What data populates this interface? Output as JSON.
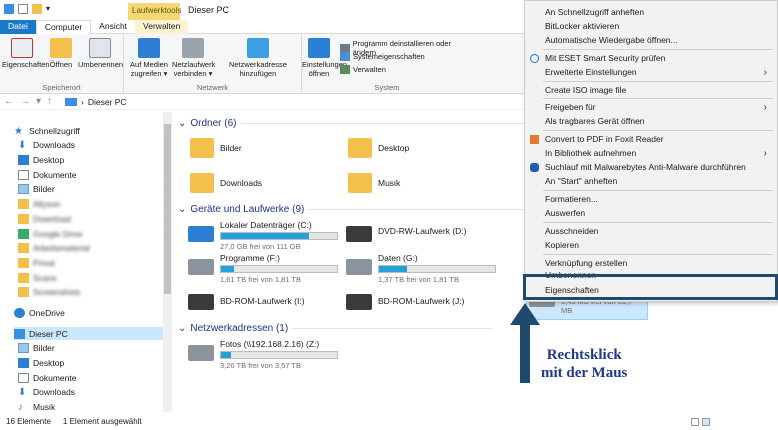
{
  "titlebar": {
    "context_tab_group": "Laufwerktools",
    "title": "Dieser PC"
  },
  "tabs": [
    {
      "label": "Datei"
    },
    {
      "label": "Computer"
    },
    {
      "label": "Ansicht"
    },
    {
      "label": "Verwalten"
    }
  ],
  "ribbon": {
    "groups": [
      {
        "label": "Speicherort"
      },
      {
        "label": "Netzwerk"
      },
      {
        "label": "System"
      }
    ],
    "buttons": {
      "properties": "Eigenschaften",
      "open": "Öffnen",
      "rename": "Umbenennen",
      "media": "Auf Medien zugreifen ▾",
      "map_drive": "Netzlaufwerk verbinden ▾",
      "add_network": "Netzwerkadresse hinzufügen",
      "settings": "Einstellungen öffnen",
      "uninstall": "Programm deinstallieren oder ändern",
      "sysprops": "Systemeigenschaften",
      "manage": "Verwalten"
    }
  },
  "address": {
    "path": "Dieser PC",
    "separator": "›"
  },
  "sidebar": {
    "quick_access": "Schnellzugriff",
    "quick_items": [
      "Downloads",
      "Desktop",
      "Dokumente",
      "Bilder"
    ],
    "blurred_items": [
      "Allyson",
      "Download",
      "Google Drive",
      "Arbeitsmaterial",
      "Privat",
      "Scans",
      "Screenshots"
    ],
    "onedrive": "OneDrive",
    "this_pc": "Dieser PC",
    "pc_items": [
      "Bilder",
      "Desktop",
      "Dokumente",
      "Downloads",
      "Musik"
    ]
  },
  "content": {
    "folders_header": "Ordner (6)",
    "folders": [
      "Bilder",
      "Desktop",
      "Downloads",
      "Musik"
    ],
    "drives_header": "Geräte und Laufwerke (9)",
    "drives": [
      {
        "name": "Lokaler Datenträger (C:)",
        "free": "27,0 GB frei von 111 GB",
        "used_fraction": 0.76
      },
      {
        "name": "DVD-RW-Laufwerk (D:)"
      },
      {
        "name": "Programme (F:)",
        "free": "1,61 TB frei von 1,81 TB",
        "used_fraction": 0.11
      },
      {
        "name": "Daten (G:)",
        "free": "1,37 TB frei von 1,81 TB",
        "used_fraction": 0.24
      },
      {
        "name": "BD-ROM-Laufwerk (I:)"
      },
      {
        "name": "BD-ROM-Laufwerk (J:)"
      },
      {
        "name": "",
        "free": "3,43 MB frei von 61,7 MB",
        "used_fraction": 0.94
      }
    ],
    "network_header": "Netzwerkadressen (1)",
    "network": [
      {
        "name": "Fotos (\\\\192.168.2.16) (Z:)",
        "free": "3,26 TB frei von 3,57 TB",
        "used_fraction": 0.09
      }
    ]
  },
  "status": {
    "count": "16 Elemente",
    "selected": "1 Element ausgewählt"
  },
  "context_menu": [
    {
      "label": "An Schnellzugriff anheften"
    },
    {
      "label": "BitLocker aktivieren"
    },
    {
      "label": "Automatische Wiedergabe öffnen..."
    },
    {
      "label": "Mit ESET Smart Security prüfen"
    },
    {
      "label": "Erweiterte Einstellungen"
    },
    {
      "label": "Create ISO image file"
    },
    {
      "label": "Freigeben für"
    },
    {
      "label": "Als tragbares Gerät öffnen"
    },
    {
      "label": "Convert to PDF in Foxit Reader"
    },
    {
      "label": "In Bibliothek aufnehmen"
    },
    {
      "label": "Suchlauf mit Malwarebytes Anti-Malware durchführen"
    },
    {
      "label": "An \"Start\" anheften"
    },
    {
      "label": "Formatieren..."
    },
    {
      "label": "Auswerfen"
    },
    {
      "label": "Ausschneiden"
    },
    {
      "label": "Kopieren"
    },
    {
      "label": "Verknüpfung erstellen"
    },
    {
      "label": "Umbenennen"
    },
    {
      "label": "Eigenschaften"
    }
  ],
  "annotation": {
    "line1": "Rechtsklick",
    "line2": "mit der Maus"
  },
  "colors": {
    "accent": "#1979ca",
    "folder": "#f3c14b",
    "bar": "#26a0da",
    "bar_full": "#da2626",
    "annotation": "#1f3a8a"
  }
}
